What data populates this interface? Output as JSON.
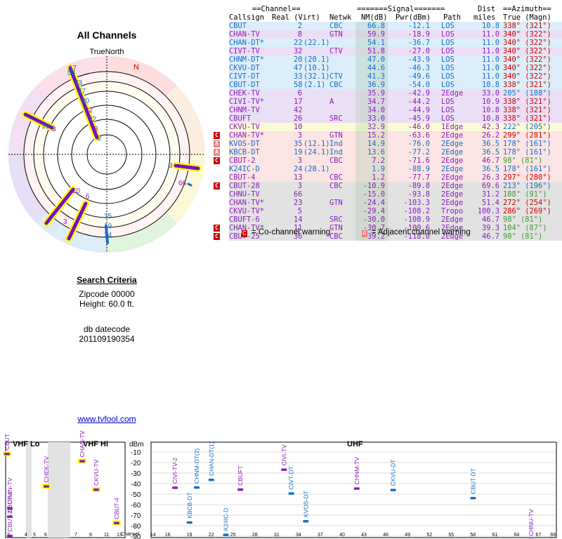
{
  "title": "All Channels",
  "north_label": "TrueNorth",
  "north_marker": "N",
  "criteria": {
    "heading": "Search Criteria",
    "zipcode": "Zipcode 00000",
    "height": "Height: 60.0 ft.",
    "datecode_label": "db datecode",
    "datecode": "201109190354",
    "link": "www.tvfool.com"
  },
  "table": {
    "group_channel": "==Channel==",
    "group_signal": "=======Signal=======",
    "group_dist": "Dist",
    "group_azimuth": "==Azimuth==",
    "h_callsign": "Callsign",
    "h_realvirt": "Real (Virt)",
    "h_netwk": "Netwk",
    "h_nm": "NM(dB)",
    "h_pwr": "Pwr(dBm)",
    "h_path": "Path",
    "h_miles": "miles",
    "h_az": "True (Magn)",
    "rows": [
      {
        "call": "CBUT",
        "real": "2",
        "virt": "",
        "net": "CBC",
        "nm": "66.8",
        "pwr": "-12.1",
        "path": "LOS",
        "dist": "10.8",
        "az": "338° (321°)",
        "bg": "#dbeefa",
        "color": "#1a6bc7",
        "azc": "#cc0000",
        "warn": ""
      },
      {
        "call": "CHAN-TV",
        "real": "8",
        "virt": "",
        "net": "GTN",
        "nm": "59.9",
        "pwr": "-18.9",
        "path": "LOS",
        "dist": "11.0",
        "az": "340° (322°)",
        "bg": "#eadff4",
        "color": "#8a1eb8",
        "azc": "#cc0000",
        "warn": ""
      },
      {
        "call": "CHAN-DT*",
        "real": "22",
        "virt": "(22.1)",
        "net": "",
        "nm": "54.1",
        "pwr": "-36.7",
        "path": "LOS",
        "dist": "11.0",
        "az": "340° (322°)",
        "bg": "#dbeefa",
        "color": "#1a6bc7",
        "azc": "#cc0000",
        "warn": ""
      },
      {
        "call": "CIVT-TV",
        "real": "32",
        "virt": "",
        "net": "CTV",
        "nm": "51.8",
        "pwr": "-27.0",
        "path": "LOS",
        "dist": "11.0",
        "az": "340° (322°)",
        "bg": "#eadff4",
        "color": "#8a1eb8",
        "azc": "#cc0000",
        "warn": ""
      },
      {
        "call": "CHNM-DT*",
        "real": "20",
        "virt": "(20.1)",
        "net": "",
        "nm": "47.0",
        "pwr": "-43.9",
        "path": "LOS",
        "dist": "11.0",
        "az": "340° (322°)",
        "bg": "#dbeefa",
        "color": "#1a6bc7",
        "azc": "#cc0000",
        "warn": ""
      },
      {
        "call": "CKVU-DT",
        "real": "47",
        "virt": "(10.1)",
        "net": "",
        "nm": "44.6",
        "pwr": "-46.3",
        "path": "LOS",
        "dist": "11.0",
        "az": "340° (322°)",
        "bg": "#dbeefa",
        "color": "#1a6bc7",
        "azc": "#cc0000",
        "warn": ""
      },
      {
        "call": "CIVT-DT",
        "real": "33",
        "virt": "(32.1)",
        "net": "CTV",
        "nm": "41.3",
        "pwr": "-49.6",
        "path": "LOS",
        "dist": "11.0",
        "az": "340° (322°)",
        "bg": "#dbeefa",
        "color": "#1a6bc7",
        "azc": "#cc0000",
        "warn": ""
      },
      {
        "call": "CBUT-DT",
        "real": "58",
        "virt": "(2.1)",
        "net": "CBC",
        "nm": "36.9",
        "pwr": "-54.0",
        "path": "LOS",
        "dist": "10.8",
        "az": "338° (321°)",
        "bg": "#dbeefa",
        "color": "#1a6bc7",
        "azc": "#cc0000",
        "warn": ""
      },
      {
        "call": "CHEK-TV",
        "real": "6",
        "virt": "",
        "net": "",
        "nm": "35.9",
        "pwr": "-42.9",
        "path": "2Edge",
        "dist": "33.0",
        "az": "205° (188°)",
        "bg": "#eadff4",
        "color": "#8a1eb8",
        "azc": "#1a6bc7",
        "warn": ""
      },
      {
        "call": "CIVI-TV*",
        "real": "17",
        "virt": "",
        "net": "A",
        "nm": "34.7",
        "pwr": "-44.2",
        "path": "LOS",
        "dist": "10.9",
        "az": "338° (321°)",
        "bg": "#eadff4",
        "color": "#8a1eb8",
        "azc": "#cc0000",
        "warn": ""
      },
      {
        "call": "CHNM-TV",
        "real": "42",
        "virt": "",
        "net": "",
        "nm": "34.0",
        "pwr": "-44.9",
        "path": "LOS",
        "dist": "10.8",
        "az": "338° (321°)",
        "bg": "#eadff4",
        "color": "#8a1eb8",
        "azc": "#cc0000",
        "warn": ""
      },
      {
        "call": "CBUFT",
        "real": "26",
        "virt": "",
        "net": "SRC",
        "nm": "33.0",
        "pwr": "-45.9",
        "path": "LOS",
        "dist": "10.8",
        "az": "338° (321°)",
        "bg": "#eadff4",
        "color": "#8a1eb8",
        "azc": "#cc0000",
        "warn": ""
      },
      {
        "call": "CKVU-TV",
        "real": "10",
        "virt": "",
        "net": "",
        "nm": "32.9",
        "pwr": "-46.0",
        "path": "1Edge",
        "dist": "42.3",
        "az": "222° (205°)",
        "bg": "#fbfbd6",
        "color": "#8a1eb8",
        "azc": "#1a6bc7",
        "warn": ""
      },
      {
        "call": "CHAN-TV*",
        "real": "3",
        "virt": "",
        "net": "GTN",
        "nm": "15.2",
        "pwr": "-63.6",
        "path": "2Edge",
        "dist": "26.2",
        "az": "299° (281°)",
        "bg": "#fbe4e4",
        "color": "#8a1eb8",
        "azc": "#cc0000",
        "warn": "C"
      },
      {
        "call": "KVOS-DT",
        "real": "35",
        "virt": "(12.1)",
        "net": "Ind",
        "nm": "14.9",
        "pwr": "-76.0",
        "path": "2Edge",
        "dist": "36.5",
        "az": "178° (161°)",
        "bg": "#fbe4e4",
        "color": "#1a6bc7",
        "azc": "#1a6bc7",
        "warn": "A"
      },
      {
        "call": "KBCB-DT",
        "real": "19",
        "virt": "(24.1)",
        "net": "Ind",
        "nm": "13.6",
        "pwr": "-77.2",
        "path": "2Edge",
        "dist": "36.5",
        "az": "178° (161°)",
        "bg": "#fbe4e4",
        "color": "#1a6bc7",
        "azc": "#1a6bc7",
        "warn": "A"
      },
      {
        "call": "CBUT-2",
        "real": "3",
        "virt": "",
        "net": "CBC",
        "nm": "7.2",
        "pwr": "-71.6",
        "path": "2Edge",
        "dist": "46.7",
        "az": "98° (81°)",
        "bg": "#fbe4e4",
        "color": "#8a1eb8",
        "azc": "#3e9c2a",
        "warn": "C"
      },
      {
        "call": "K24IC-D",
        "real": "24",
        "virt": "(28.1)",
        "net": "",
        "nm": "1.9",
        "pwr": "-88.9",
        "path": "2Edge",
        "dist": "36.5",
        "az": "178° (161°)",
        "bg": "#fbe4e4",
        "color": "#1a6bc7",
        "azc": "#1a6bc7",
        "warn": ""
      },
      {
        "call": "CBUT-4",
        "real": "13",
        "virt": "",
        "net": "CBC",
        "nm": "1.2",
        "pwr": "-77.7",
        "path": "2Edge",
        "dist": "26.3",
        "az": "297° (280°)",
        "bg": "#fbe4e4",
        "color": "#8a1eb8",
        "azc": "#cc0000",
        "warn": ""
      },
      {
        "call": "CBUT-28",
        "real": "3",
        "virt": "",
        "net": "CBC",
        "nm": "-10.9",
        "pwr": "-89.8",
        "path": "2Edge",
        "dist": "69.6",
        "az": "213° (196°)",
        "bg": "#e2e2e2",
        "color": "#8a1eb8",
        "azc": "#1a6bc7",
        "warn": "C"
      },
      {
        "call": "CHNU-TV",
        "real": "66",
        "virt": "",
        "net": "",
        "nm": "-15.0",
        "pwr": "-93.8",
        "path": "2Edge",
        "dist": "31.2",
        "az": "108° (91°)",
        "bg": "#e2e2e2",
        "color": "#8a1eb8",
        "azc": "#3e9c2a",
        "warn": ""
      },
      {
        "call": "CHAN-TV*",
        "real": "23",
        "virt": "",
        "net": "GTN",
        "nm": "-24.4",
        "pwr": "-103.3",
        "path": "2Edge",
        "dist": "51.4",
        "az": "272° (254°)",
        "bg": "#e2e2e2",
        "color": "#8a1eb8",
        "azc": "#cc0000",
        "warn": ""
      },
      {
        "call": "CKVU-TV*",
        "real": "5",
        "virt": "",
        "net": "",
        "nm": "-29.4",
        "pwr": "-108.2",
        "path": "Tropo",
        "dist": "100.3",
        "az": "286° (269°)",
        "bg": "#e2e2e2",
        "color": "#8a1eb8",
        "azc": "#cc0000",
        "warn": ""
      },
      {
        "call": "CBUFT-6",
        "real": "14",
        "virt": "",
        "net": "SRC",
        "nm": "-30.0",
        "pwr": "-108.9",
        "path": "2Edge",
        "dist": "46.7",
        "az": "98° (81°)",
        "bg": "#e2e2e2",
        "color": "#8a1eb8",
        "azc": "#3e9c2a",
        "warn": ""
      },
      {
        "call": "CHAN-TV*",
        "real": "11",
        "virt": "",
        "net": "GTN",
        "nm": "-30.7",
        "pwr": "-109.6",
        "path": "2Edge",
        "dist": "39.3",
        "az": "104° (87°)",
        "bg": "#e2e2e2",
        "color": "#8a1eb8",
        "azc": "#3e9c2a",
        "warn": "C"
      },
      {
        "call": "CBUT-25",
        "real": "36",
        "virt": "",
        "net": "CBC",
        "nm": "-39.2",
        "pwr": "-118.0",
        "path": "2Edge",
        "dist": "46.7",
        "az": "98° (81°)",
        "bg": "#e2e2e2",
        "color": "#8a1eb8",
        "azc": "#3e9c2a",
        "warn": "C"
      }
    ]
  },
  "legend": {
    "co_mark": "C",
    "co_text": "= Co-channel warning",
    "adj_mark": "A",
    "adj_text": "= Adjacent channel warning"
  },
  "colors": {
    "red": "#cc0000",
    "blue": "#1a6bc7",
    "purple": "#8a1eb8",
    "green": "#3e9c2a",
    "yellow": "#ffff00"
  },
  "radar": {
    "labels": [
      {
        "text": "17",
        "c": "#8a1eb8"
      },
      {
        "text": "58",
        "c": "#1a6bc7"
      },
      {
        "text": "33",
        "c": "#1a6bc7"
      },
      {
        "text": "47",
        "c": "#1a6bc7"
      },
      {
        "text": "20",
        "c": "#1a6bc7"
      },
      {
        "text": "32",
        "c": "#8a1eb8"
      },
      {
        "text": "22",
        "c": "#1a6bc7"
      },
      {
        "text": "8",
        "c": "#8a1eb8"
      },
      {
        "text": "2",
        "c": "#1a6bc7"
      },
      {
        "text": "19",
        "c": "#1a6bc7"
      },
      {
        "text": "3",
        "c": "#8a1eb8"
      },
      {
        "text": "10",
        "c": "#8a1eb8"
      },
      {
        "text": "6",
        "c": "#8a1eb8"
      },
      {
        "text": "3",
        "c": "#8a1eb8"
      },
      {
        "text": "35",
        "c": "#1a6bc7"
      },
      {
        "text": "19",
        "c": "#1a6bc7"
      },
      {
        "text": "24",
        "c": "#1a6bc7"
      },
      {
        "text": "3",
        "c": "#8a1eb8"
      },
      {
        "text": "66",
        "c": "#8a1eb8"
      }
    ]
  },
  "spectrum": {
    "dbm_label": "dBm",
    "vhf_lo": "VHF Lo",
    "vhf_hi": "VHF Hi",
    "uhf": "UHF",
    "channel_label": "Channel",
    "dbm_ticks": [
      "-10",
      "-20",
      "-30",
      "-40",
      "-50",
      "-60",
      "-70",
      "-80",
      "-90"
    ],
    "lo_ticks": [
      "2",
      "4",
      "5",
      "6",
      "7"
    ],
    "hi_ticks": [
      "9",
      "11",
      "13"
    ],
    "uhf_ticks": [
      "14",
      "16",
      "19",
      "22",
      "25",
      "28",
      "31",
      "34",
      "37",
      "40",
      "43",
      "46",
      "49",
      "52",
      "55",
      "58",
      "61",
      "64",
      "67",
      "69"
    ],
    "stations": [
      {
        "ch": 2,
        "dbm": -12.1,
        "label": "CBUT",
        "c": "#8a1eb8",
        "hl": true
      },
      {
        "ch": 3,
        "dbm": -63.6,
        "label": "CHAN-TV",
        "c": "#8a1eb8",
        "hl": false
      },
      {
        "ch": 3,
        "dbm": -71.6,
        "label": "CBUT-2",
        "c": "#8a1eb8",
        "hl": false
      },
      {
        "ch": 3,
        "dbm": -89.8,
        "label": "CBUT-28",
        "c": "#8a1eb8",
        "hl": false
      },
      {
        "ch": 6,
        "dbm": -42.9,
        "label": "CHEK-TV",
        "c": "#8a1eb8",
        "hl": true
      },
      {
        "ch": 8,
        "dbm": -18.9,
        "label": "CHAN-TV",
        "c": "#8a1eb8",
        "hl": true
      },
      {
        "ch": 10,
        "dbm": -46.0,
        "label": "CKVU-TV",
        "c": "#8a1eb8",
        "hl": true
      },
      {
        "ch": 13,
        "dbm": -77.7,
        "label": "CBUT-4",
        "c": "#8a1eb8",
        "hl": true
      },
      {
        "ch": 17,
        "dbm": -44.2,
        "label": "CIVI-TV-2",
        "c": "#8a1eb8",
        "hl": false
      },
      {
        "ch": 19,
        "dbm": -77.2,
        "label": "KBCB-DT",
        "c": "#1a6bc7",
        "hl": false
      },
      {
        "ch": 20,
        "dbm": -43.9,
        "label": "CHNM-DT(2)",
        "c": "#1a6bc7",
        "hl": false
      },
      {
        "ch": 22,
        "dbm": -36.7,
        "label": "CHAN-DT(1)",
        "c": "#1a6bc7",
        "hl": false
      },
      {
        "ch": 24,
        "dbm": -88.9,
        "label": "K24IC-D",
        "c": "#1a6bc7",
        "hl": false
      },
      {
        "ch": 26,
        "dbm": -45.9,
        "label": "CBUFT",
        "c": "#8a1eb8",
        "hl": false
      },
      {
        "ch": 32,
        "dbm": -27.0,
        "label": "CIVI-TV",
        "c": "#8a1eb8",
        "hl": false
      },
      {
        "ch": 33,
        "dbm": -49.6,
        "label": "CIVT-DT",
        "c": "#1a6bc7",
        "hl": false
      },
      {
        "ch": 35,
        "dbm": -76.0,
        "label": "KVOS-DT",
        "c": "#1a6bc7",
        "hl": false
      },
      {
        "ch": 42,
        "dbm": -44.9,
        "label": "CHNM-TV",
        "c": "#8a1eb8",
        "hl": false
      },
      {
        "ch": 47,
        "dbm": -46.3,
        "label": "CKVU-DT",
        "c": "#1a6bc7",
        "hl": false
      },
      {
        "ch": 58,
        "dbm": -54.0,
        "label": "CBUT-DT",
        "c": "#1a6bc7",
        "hl": false
      },
      {
        "ch": 66,
        "dbm": -93.8,
        "label": "CHNU-TV",
        "c": "#8a1eb8",
        "hl": false
      }
    ]
  }
}
